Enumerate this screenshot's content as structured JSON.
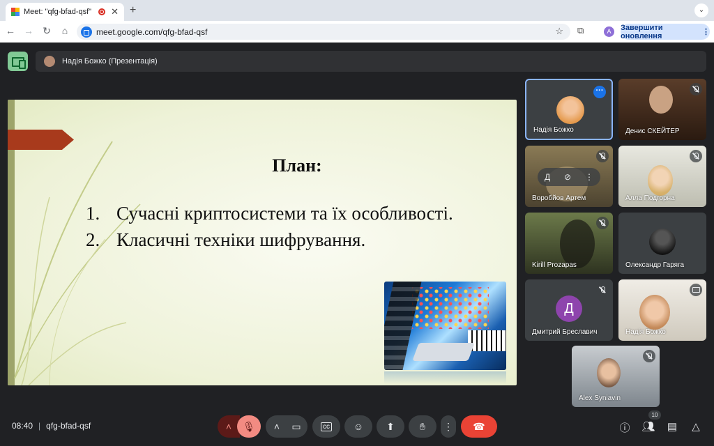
{
  "browser": {
    "tab_title": "Meet: \"qfg-bfad-qsf\"",
    "tab_close": "✕",
    "new_tab": "+",
    "tab_menu": "⌄",
    "url": "meet.google.com/qfg-bfad-qsf",
    "profile_letter": "A",
    "update_button": "Завершити оновлення",
    "update_menu": "⋮"
  },
  "meet": {
    "presenter_bar": "Надія Божко (Презентація)",
    "meeting_code": "qfg-bfad-qsf",
    "time": "08:40",
    "participant_count": "10"
  },
  "slide": {
    "title": "План:",
    "items": [
      {
        "num": "1.",
        "text": "Сучасні криптосистеми та їх особливості."
      },
      {
        "num": "2.",
        "text": "Класичні техніки шифрування."
      }
    ]
  },
  "participants": [
    {
      "name": "Надія Божко"
    },
    {
      "name": "Денис СКЕЙТЕР"
    },
    {
      "name": "Воробйов Артем",
      "hover_letter": "Д"
    },
    {
      "name": "Алла Подгорна"
    },
    {
      "name": "Kirill Prozapas"
    },
    {
      "name": "Олександр Гаряга"
    },
    {
      "name": "Дмитрий Бреславич",
      "avatar_letter": "Д"
    },
    {
      "name": "Надія Божко"
    },
    {
      "name": "Alex Syniavin"
    }
  ],
  "colors": {
    "accent_blue": "#1a73e8",
    "mic_off_red": "#f28b82",
    "end_call_red": "#ea4335",
    "slide_arrow": "#a83a1c"
  }
}
